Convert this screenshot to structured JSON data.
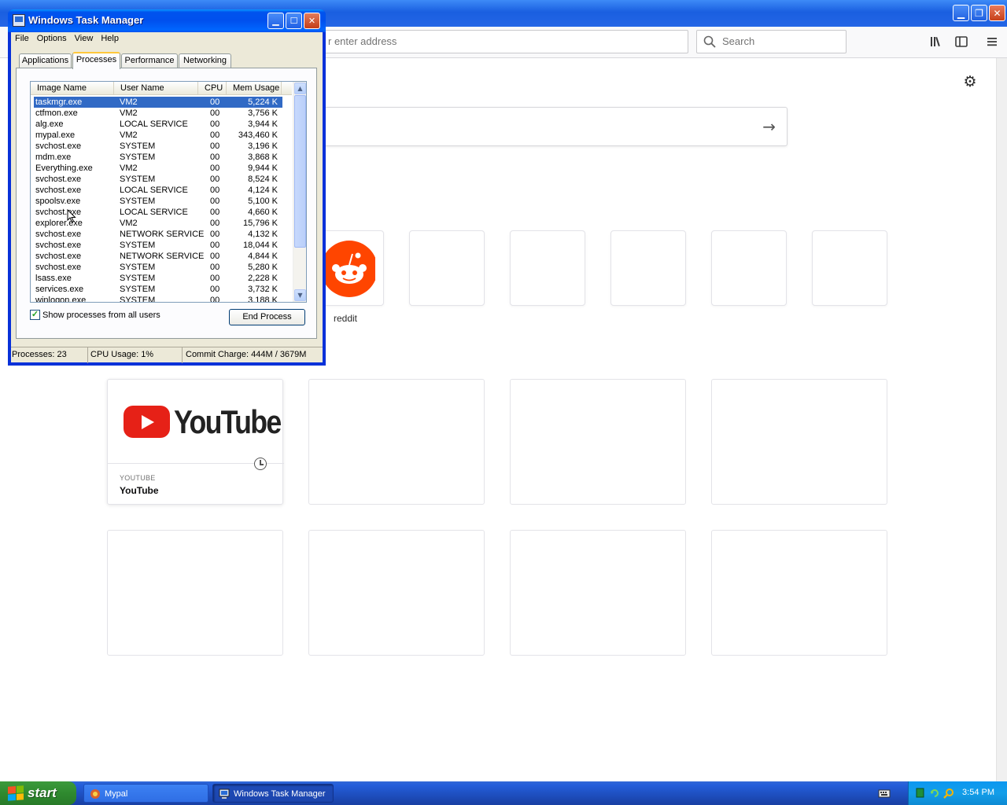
{
  "browser": {
    "url_placeholder": "r enter address",
    "search_placeholder": "Search",
    "top_sites": [
      {
        "label": "reddit"
      }
    ],
    "highlights": [
      {
        "host": "YOUTUBE",
        "title": "YouTube",
        "logo_text": "YouTube"
      }
    ]
  },
  "taskmgr": {
    "title": "Windows Task Manager",
    "menu": [
      "File",
      "Options",
      "View",
      "Help"
    ],
    "tabs": [
      "Applications",
      "Processes",
      "Performance",
      "Networking"
    ],
    "active_tab": "Processes",
    "columns": [
      "Image Name",
      "User Name",
      "CPU",
      "Mem Usage"
    ],
    "processes": [
      [
        "taskmgr.exe",
        "VM2",
        "00",
        "5,224 K"
      ],
      [
        "ctfmon.exe",
        "VM2",
        "00",
        "3,756 K"
      ],
      [
        "alg.exe",
        "LOCAL SERVICE",
        "00",
        "3,944 K"
      ],
      [
        "mypal.exe",
        "VM2",
        "00",
        "343,460 K"
      ],
      [
        "svchost.exe",
        "SYSTEM",
        "00",
        "3,196 K"
      ],
      [
        "mdm.exe",
        "SYSTEM",
        "00",
        "3,868 K"
      ],
      [
        "Everything.exe",
        "VM2",
        "00",
        "9,944 K"
      ],
      [
        "svchost.exe",
        "SYSTEM",
        "00",
        "8,524 K"
      ],
      [
        "svchost.exe",
        "LOCAL SERVICE",
        "00",
        "4,124 K"
      ],
      [
        "spoolsv.exe",
        "SYSTEM",
        "00",
        "5,100 K"
      ],
      [
        "svchost.exe",
        "LOCAL SERVICE",
        "00",
        "4,660 K"
      ],
      [
        "explorer.exe",
        "VM2",
        "00",
        "15,796 K"
      ],
      [
        "svchost.exe",
        "NETWORK SERVICE",
        "00",
        "4,132 K"
      ],
      [
        "svchost.exe",
        "SYSTEM",
        "00",
        "18,044 K"
      ],
      [
        "svchost.exe",
        "NETWORK SERVICE",
        "00",
        "4,844 K"
      ],
      [
        "svchost.exe",
        "SYSTEM",
        "00",
        "5,280 K"
      ],
      [
        "lsass.exe",
        "SYSTEM",
        "00",
        "2,228 K"
      ],
      [
        "services.exe",
        "SYSTEM",
        "00",
        "3,732 K"
      ],
      [
        "winlogon.exe",
        "SYSTEM",
        "00",
        "3,188 K"
      ]
    ],
    "selected_process": "taskmgr.exe",
    "show_all_label": "Show processes from all users",
    "show_all_checked": true,
    "end_process_label": "End Process",
    "status": {
      "processes": "Processes: 23",
      "cpu": "CPU Usage: 1%",
      "commit": "Commit Charge: 444M / 3679M"
    }
  },
  "taskbar": {
    "start_label": "start",
    "tasks": [
      {
        "label": "Mypal"
      },
      {
        "label": "Windows Task Manager"
      }
    ],
    "clock": "3:54 PM"
  },
  "colors": {
    "xp_blue": "#0053ee",
    "selection": "#316ac5",
    "start_green": "#3c9a3c",
    "reddit_orange": "#ff4500",
    "youtube_red": "#e62117"
  }
}
